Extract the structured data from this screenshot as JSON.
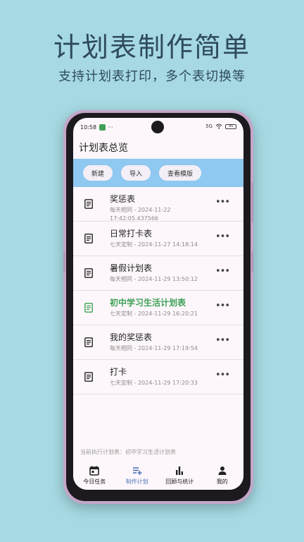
{
  "promo": {
    "title": "计划表制作简单",
    "subtitle": "支持计划表打印，多个表切换等"
  },
  "status_bar": {
    "time": "10:58",
    "dots": "···",
    "signal": "5G",
    "battery": "95"
  },
  "header": {
    "title": "计划表总览"
  },
  "toolbar": {
    "new_label": "新建",
    "import_label": "导入",
    "templates_label": "查看模版"
  },
  "plans": [
    {
      "title": "奖惩表",
      "meta": "每天相同 -  2024-11-22 17:42:05.437566",
      "active": false
    },
    {
      "title": "日常打卡表",
      "meta": "七天定制 -  2024-11-27 14:18:14",
      "active": false
    },
    {
      "title": "暑假计划表",
      "meta": "每天相同 -  2024-11-29 13:50:12",
      "active": false
    },
    {
      "title": "初中学习生活计划表",
      "meta": "七天定制 -  2024-11-29 16:20:21",
      "active": true
    },
    {
      "title": "我的奖惩表",
      "meta": "每天相同 -  2024-11-29 17:19:54",
      "active": false
    },
    {
      "title": "打卡",
      "meta": "七天定制 -  2024-11-29 17:20:33",
      "active": false
    }
  ],
  "more_glyph": "•••",
  "current_plan_text": "当前执行计划表：初中学习生活计划表",
  "bottom_nav": [
    {
      "label": "今日任务",
      "icon": "calendar-icon",
      "active": false
    },
    {
      "label": "制作计划",
      "icon": "playlist-add-icon",
      "active": true
    },
    {
      "label": "回顾与统计",
      "icon": "bar-chart-icon",
      "active": false
    },
    {
      "label": "我的",
      "icon": "person-icon",
      "active": false
    }
  ],
  "colors": {
    "background": "#a6d9e3",
    "toolbar": "#8fc8f0",
    "active_text": "#3fa157",
    "nav_active": "#4f73b6"
  }
}
